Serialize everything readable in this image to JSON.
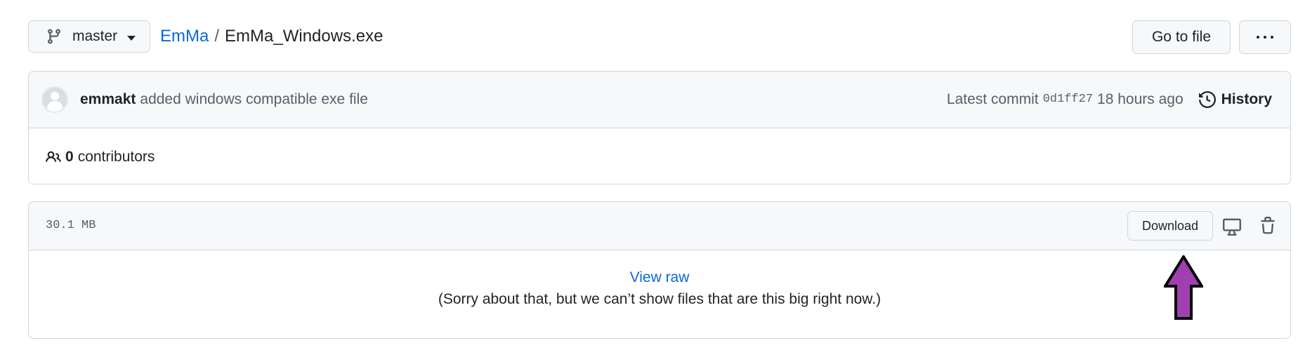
{
  "header": {
    "branch": "master",
    "repo": "EmMa",
    "separator": "/",
    "file_name": "EmMa_Windows.exe",
    "go_to_file": "Go to file"
  },
  "commit": {
    "author": "emmakt",
    "message": "added windows compatible exe file",
    "latest_label": "Latest commit",
    "sha": "0d1ff27",
    "time": "18 hours ago",
    "history_label": "History"
  },
  "contributors": {
    "count": "0",
    "label": "contributors"
  },
  "file": {
    "size": "30.1 MB",
    "download_label": "Download",
    "view_raw": "View raw",
    "notice": "(Sorry about that, but we can’t show files that are this big right now.)"
  },
  "annotation": {
    "arrow_color": "#a040b0"
  }
}
